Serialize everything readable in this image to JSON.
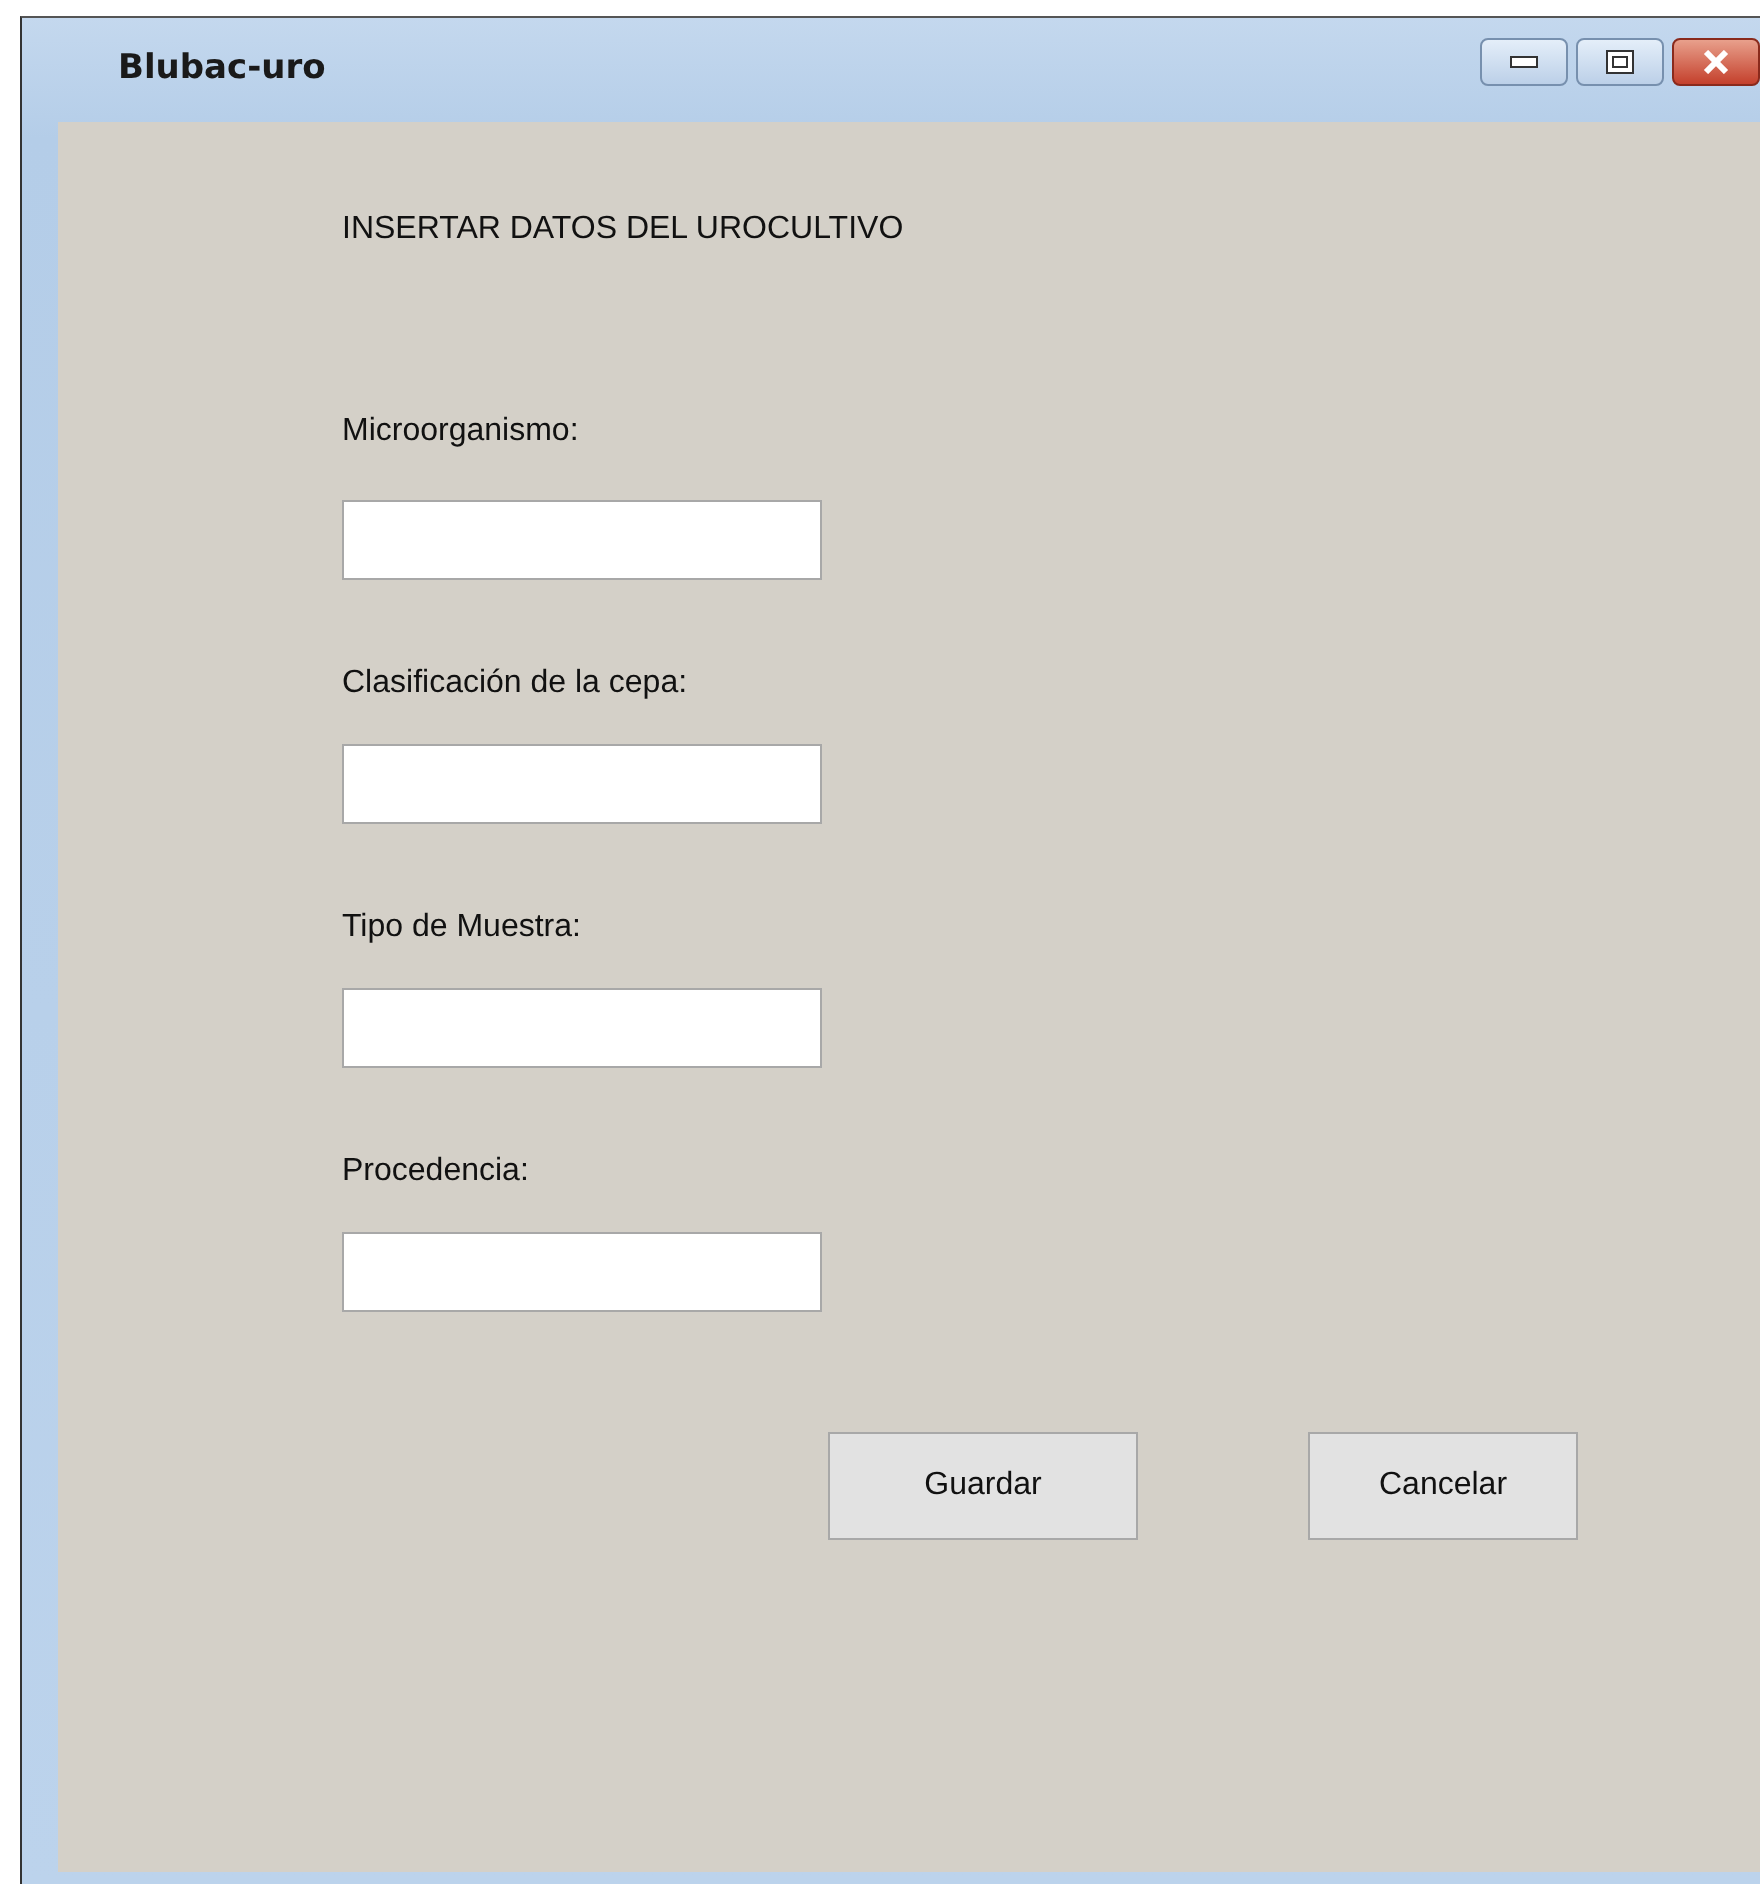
{
  "window": {
    "title": "Blubac-uro"
  },
  "heading": "INSERTAR DATOS DEL UROCULTIVO",
  "fields": [
    {
      "label": "Microorganismo:"
    },
    {
      "label": "Clasificación de la cepa:"
    },
    {
      "label": "Tipo de Muestra:"
    },
    {
      "label": "Procedencia:"
    }
  ],
  "buttons": [
    "Guardar",
    "Cancelar"
  ]
}
